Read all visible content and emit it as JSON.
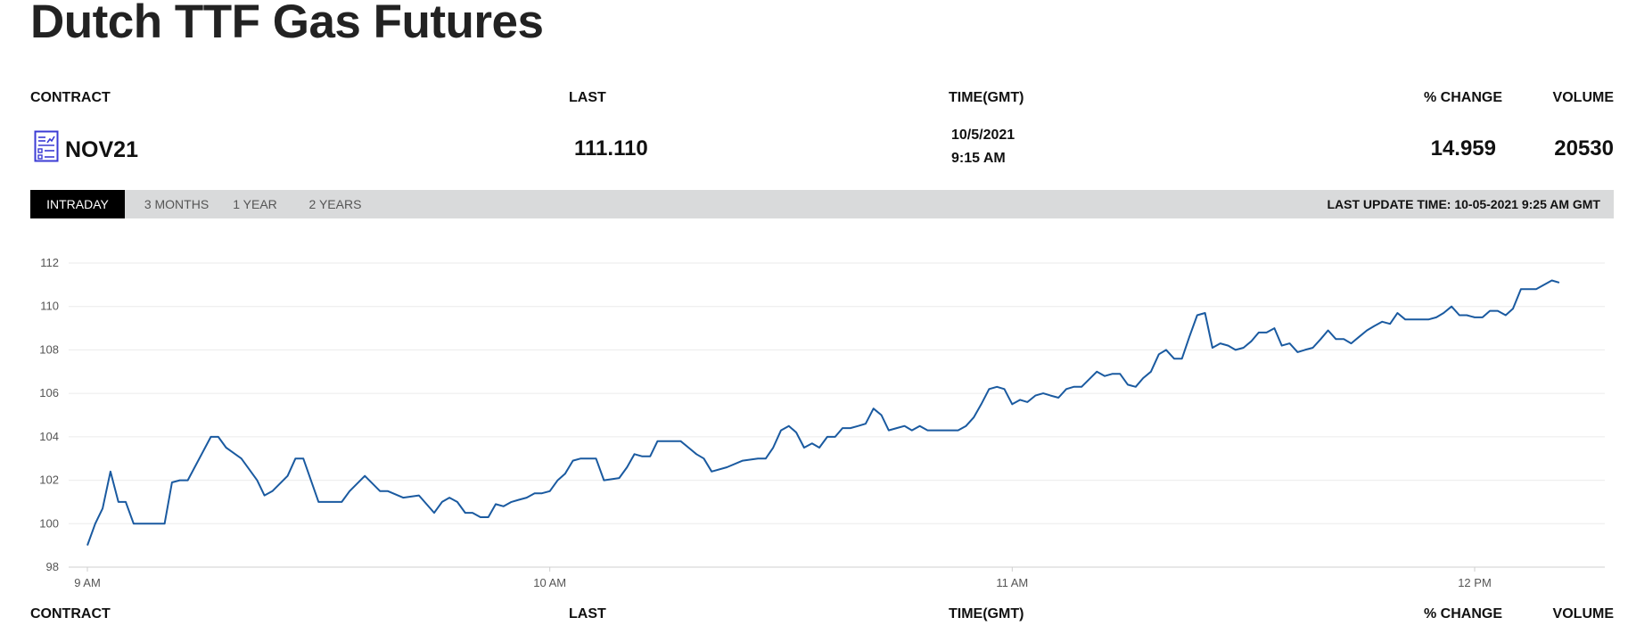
{
  "page": {
    "title": "Dutch TTF Gas Futures"
  },
  "table": {
    "headers": {
      "contract": "CONTRACT",
      "last": "LAST",
      "time": "TIME(GMT)",
      "change": "% CHANGE",
      "volume": "VOLUME"
    },
    "row": {
      "contract": "NOV21",
      "last": "111.110",
      "date": "10/5/2021",
      "time": "9:15 AM",
      "change": "14.959",
      "volume": "20530",
      "icon": "document-chart-icon"
    }
  },
  "tabs": [
    {
      "label": "INTRADAY",
      "active": true
    },
    {
      "label": "3 MONTHS",
      "active": false
    },
    {
      "label": "1 YEAR",
      "active": false
    },
    {
      "label": "2 YEARS",
      "active": false
    }
  ],
  "last_update": "LAST UPDATE TIME: 10-05-2021 9:25 AM GMT",
  "colors": {
    "line": "#1a5aa0",
    "active_tab": "#000000",
    "tabbar": "#d9dadb",
    "icon": "#3b3bd4"
  },
  "chart_data": {
    "type": "line",
    "xlim": [
      9,
      12.28
    ],
    "ylim": [
      98,
      112
    ],
    "yticks": [
      98,
      100,
      102,
      104,
      106,
      108,
      110,
      112
    ],
    "xticks": [
      {
        "value": 9,
        "label": "9 AM"
      },
      {
        "value": 10,
        "label": "10 AM"
      },
      {
        "value": 11,
        "label": "11 AM"
      },
      {
        "value": 12,
        "label": "12 PM"
      }
    ],
    "grid": true,
    "x": [
      9.0,
      9.017,
      9.033,
      9.05,
      9.067,
      9.083,
      9.1,
      9.133,
      9.167,
      9.183,
      9.2,
      9.217,
      9.267,
      9.283,
      9.3,
      9.333,
      9.367,
      9.383,
      9.4,
      9.433,
      9.45,
      9.467,
      9.5,
      9.533,
      9.55,
      9.567,
      9.6,
      9.633,
      9.65,
      9.683,
      9.717,
      9.75,
      9.767,
      9.783,
      9.8,
      9.817,
      9.833,
      9.85,
      9.867,
      9.883,
      9.9,
      9.917,
      9.933,
      9.95,
      9.967,
      9.983,
      10.0,
      10.017,
      10.033,
      10.05,
      10.067,
      10.083,
      10.1,
      10.117,
      10.15,
      10.167,
      10.183,
      10.2,
      10.217,
      10.233,
      10.25,
      10.267,
      10.283,
      10.3,
      10.317,
      10.333,
      10.35,
      10.383,
      10.417,
      10.45,
      10.467,
      10.483,
      10.5,
      10.517,
      10.533,
      10.55,
      10.567,
      10.583,
      10.6,
      10.617,
      10.633,
      10.65,
      10.667,
      10.683,
      10.7,
      10.717,
      10.733,
      10.75,
      10.767,
      10.783,
      10.8,
      10.817,
      10.833,
      10.85,
      10.867,
      10.883,
      10.9,
      10.917,
      10.933,
      10.95,
      10.967,
      10.983,
      11.0,
      11.017,
      11.033,
      11.05,
      11.067,
      11.083,
      11.1,
      11.117,
      11.133,
      11.15,
      11.183,
      11.2,
      11.217,
      11.233,
      11.25,
      11.267,
      11.283,
      11.3,
      11.317,
      11.333,
      11.35,
      11.367,
      11.383,
      11.4,
      11.417,
      11.433,
      11.45,
      11.467,
      11.483,
      11.5,
      11.517,
      11.533,
      11.55,
      11.567,
      11.583,
      11.6,
      11.617,
      11.633,
      11.65,
      11.667,
      11.683,
      11.7,
      11.717,
      11.733,
      11.75,
      11.767,
      11.783,
      11.8,
      11.817,
      11.833,
      11.85,
      11.867,
      11.883,
      11.9,
      11.917,
      11.933,
      11.95,
      11.967,
      11.983,
      12.0,
      12.017,
      12.033,
      12.05,
      12.067,
      12.083,
      12.1,
      12.117,
      12.133,
      12.15,
      12.167,
      12.183,
      12.2,
      12.217,
      12.233,
      12.25
    ],
    "values": [
      99.0,
      100.0,
      100.7,
      102.4,
      101.0,
      101.0,
      100.0,
      100.0,
      100.0,
      101.9,
      102.0,
      102.0,
      104.0,
      104.0,
      103.5,
      103.0,
      102.0,
      101.3,
      101.5,
      102.2,
      103.0,
      103.0,
      101.0,
      101.0,
      101.0,
      101.5,
      102.2,
      101.5,
      101.5,
      101.2,
      101.3,
      100.5,
      101.0,
      101.2,
      101.0,
      100.5,
      100.5,
      100.3,
      100.3,
      100.9,
      100.8,
      101.0,
      101.1,
      101.2,
      101.4,
      101.4,
      101.5,
      102.0,
      102.3,
      102.9,
      103.0,
      103.0,
      103.0,
      102.0,
      102.1,
      102.6,
      103.2,
      103.1,
      103.1,
      103.8,
      103.8,
      103.8,
      103.8,
      103.5,
      103.2,
      103.0,
      102.4,
      102.6,
      102.9,
      103.0,
      103.0,
      103.5,
      104.3,
      104.5,
      104.2,
      103.5,
      103.7,
      103.5,
      104.0,
      104.0,
      104.4,
      104.4,
      104.5,
      104.6,
      105.3,
      105.0,
      104.3,
      104.4,
      104.5,
      104.3,
      104.5,
      104.3,
      104.3,
      104.3,
      104.3,
      104.3,
      104.5,
      104.9,
      105.5,
      106.2,
      106.3,
      106.2,
      105.5,
      105.7,
      105.6,
      105.9,
      106.0,
      105.9,
      105.8,
      106.2,
      106.3,
      106.3,
      107.0,
      106.8,
      106.9,
      106.9,
      106.4,
      106.3,
      106.7,
      107.0,
      107.8,
      108.0,
      107.6,
      107.6,
      108.6,
      109.6,
      109.7,
      108.1,
      108.3,
      108.2,
      108.0,
      108.1,
      108.4,
      108.8,
      108.8,
      109.0,
      108.2,
      108.3,
      107.9,
      108.0,
      108.1,
      108.5,
      108.9,
      108.5,
      108.5,
      108.3,
      108.6,
      108.9,
      109.1,
      109.3,
      109.2,
      109.7,
      109.4,
      109.4,
      109.4,
      109.4,
      109.5,
      109.7,
      110.0,
      109.6,
      109.6,
      109.5,
      109.5,
      109.8,
      109.8,
      109.6,
      109.9,
      110.8,
      110.8,
      110.8,
      111.0,
      111.2,
      111.1
    ]
  }
}
